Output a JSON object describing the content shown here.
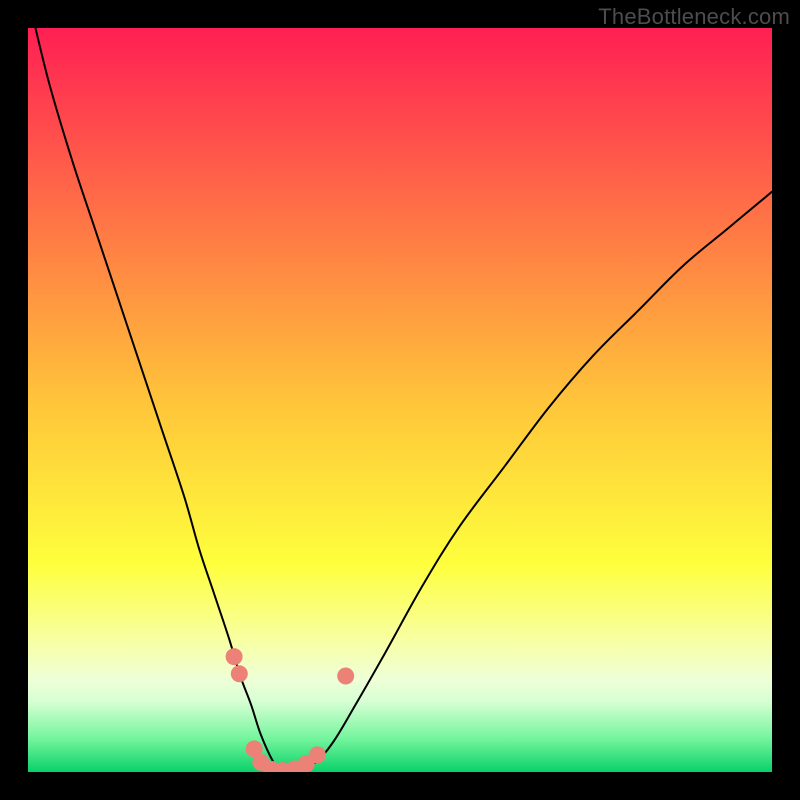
{
  "watermark": "TheBottleneck.com",
  "chart_data": {
    "type": "line",
    "title": "",
    "xlabel": "",
    "ylabel": "",
    "xlim": [
      0,
      100
    ],
    "ylim": [
      0,
      100
    ],
    "grid": false,
    "legend": false,
    "background_gradient": {
      "stops": [
        {
          "offset": 0.0,
          "color": "#ff1f53"
        },
        {
          "offset": 0.5,
          "color": "#ffc43a"
        },
        {
          "offset": 0.72,
          "color": "#feff3c"
        },
        {
          "offset": 0.82,
          "color": "#f8ffa0"
        },
        {
          "offset": 0.875,
          "color": "#efffd7"
        },
        {
          "offset": 0.905,
          "color": "#d7ffd4"
        },
        {
          "offset": 0.955,
          "color": "#74f59d"
        },
        {
          "offset": 1.0,
          "color": "#09d169"
        }
      ]
    },
    "series": [
      {
        "name": "bottleneck-curve",
        "color": "#000000",
        "width": 2,
        "x": [
          1,
          3,
          6,
          9,
          12,
          15,
          18,
          21,
          23,
          25,
          27,
          28.5,
          30,
          31.3,
          33,
          34,
          36,
          38.5,
          41,
          44,
          48,
          53,
          58,
          64,
          70,
          76,
          82,
          88,
          94,
          100
        ],
        "y": [
          100,
          92,
          82,
          73,
          64,
          55,
          46,
          37,
          30,
          24,
          18,
          13,
          9,
          5,
          1.3,
          0.3,
          0.3,
          1.2,
          4,
          9,
          16,
          25,
          33,
          41,
          49,
          56,
          62,
          68,
          73,
          78
        ]
      }
    ],
    "markers": {
      "color": "#ec8277",
      "radius": 8.5,
      "points": [
        {
          "x": 27.7,
          "y": 15.5
        },
        {
          "x": 28.4,
          "y": 13.2
        },
        {
          "x": 30.4,
          "y": 3.1
        },
        {
          "x": 31.3,
          "y": 1.3
        },
        {
          "x": 32.7,
          "y": 0.35
        },
        {
          "x": 34.2,
          "y": 0.18
        },
        {
          "x": 35.8,
          "y": 0.4
        },
        {
          "x": 37.4,
          "y": 1.1
        },
        {
          "x": 38.9,
          "y": 2.3
        },
        {
          "x": 42.7,
          "y": 12.9
        }
      ]
    }
  }
}
